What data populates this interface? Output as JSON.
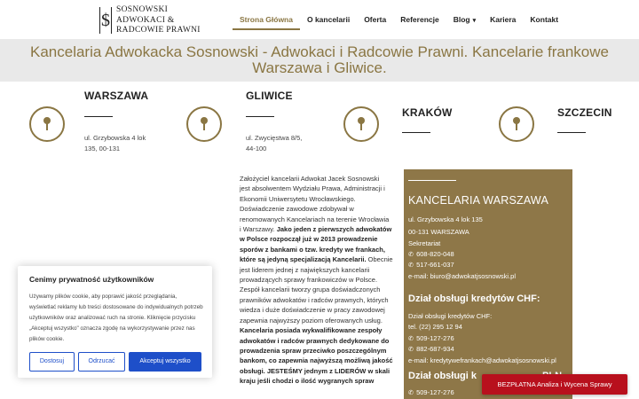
{
  "header": {
    "logo_mark": "$",
    "logo_lines": [
      "SOSNOWSKI",
      "ADWOKACI &",
      "RADCOWIE PRAWNI"
    ],
    "nav": [
      {
        "label": "Strona Główna",
        "active": true
      },
      {
        "label": "O kancelarii"
      },
      {
        "label": "Oferta"
      },
      {
        "label": "Referencje"
      },
      {
        "label": "Blog",
        "has_caret": true
      },
      {
        "label": "Kariera"
      },
      {
        "label": "Kontakt"
      }
    ],
    "caret": "▾"
  },
  "hero": {
    "title": "Kancelaria Adwokacka Sosnowski - Adwokaci i Radcowie Prawni. Kancelarie frankowe Warszawa i Gliwice."
  },
  "offices": [
    {
      "name": "WARSZAWA",
      "address": [
        "ul. Grzybowska 4 lok",
        "135, 00-131"
      ]
    },
    {
      "name": "GLIWICE",
      "address": [
        "ul. Zwycięstwa 8/5,",
        "44-100"
      ]
    },
    {
      "name": "KRAKÓW",
      "address": []
    },
    {
      "name": "SZCZECIN",
      "address": []
    }
  ],
  "about": {
    "lines": [
      "Założyciel kancelarii Adwokat Jacek Sosnowski",
      "jest absolwentem Wydziału Prawa, Administracji i",
      "Ekonomii Uniwersytetu Wrocławskiego.",
      "Doświadczenie zawodowe zdobywał w",
      "renomowanych Kancelariach na terenie Wrocławia",
      "i Warszawy.",
      "Jako jeden z pierwszych adwokatów",
      "w Polsce rozpoczął już w 2013 prowadzenie",
      "sporów z bankami o tzw. kredyty we frankach,",
      "które są jedyną specjalizacją Kancelarii.",
      "Obecnie",
      "jest liderem jednej z największych kancelarii",
      "prowadzących sprawy frankowiczów w Polsce.",
      "Zespół kancelarii tworzy grupa doświadczonych",
      "prawników adwokatów i radców prawnych, których",
      "wiedza i duże doświadczenie w pracy zawodowej",
      "zapewnia najwyższy poziom oferowanych usług.",
      "Kancelaria posiada wykwalifikowane zespoły",
      "adwokatów i radców prawnych dedykowane do",
      "prowadzenia spraw przeciwko poszczególnym",
      "bankom, co zapewnia najwyższą możliwą jakość",
      "obsługi. JESTEŚMY jednym z LIDERÓW w skali",
      "kraju jeśli chodzi o ilość wygranych spraw"
    ]
  },
  "panel": {
    "title": "KANCELARIA WARSZAWA",
    "address1": "ul. Grzybowska 4 lok 135",
    "address2": "00-131 WARSZAWA",
    "secretariat": "Sekretariat",
    "phone1": "608-820-048",
    "phone2": "517-661-037",
    "email": "e-mail: biuro@adwokatjsosnowski.pl",
    "chf_heading": "Dział obsługi kredytów CHF:",
    "chf_label": "Dział obsługi kredytów CHF:",
    "chf_tel": "tel. (22) 295 12 94",
    "chf_phone1": "509-127-276",
    "chf_phone2": "882-687-934",
    "chf_email": "e-mail: kredytywefrankach@adwokatjsosnowski.pl",
    "chf_heading2_visible": "Dział obsługi k",
    "chf_heading2_tail": "PLN",
    "chf2_phone": "509-127-276",
    "phone_icon": "phone-icon"
  },
  "cookie": {
    "title": "Cenimy prywatność użytkowników",
    "text": "Używamy plików cookie, aby poprawić jakość przeglądania, wyświetlać reklamy lub treści dostosowane do indywidualnych potrzeb użytkowników oraz analizować ruch na stronie. Kliknięcie przycisku „Akceptuj wszystko\" oznacza zgodę na wykorzystywanie przez nas plików cookie.",
    "customize": "Dostosuj",
    "reject": "Odrzucać",
    "accept": "Akceptuj wszystko"
  },
  "cta": {
    "label": "BEZPŁATNA Analiza i Wycena Sprawy"
  },
  "colors": {
    "gold": "#8e7748",
    "accent_text": "#8a7643",
    "cookie_blue": "#1e4fc9",
    "cta_red": "#b8101d"
  }
}
